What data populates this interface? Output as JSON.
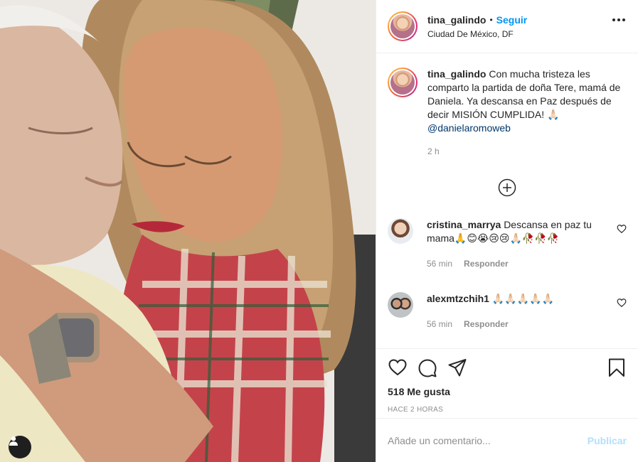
{
  "header": {
    "username": "tina_galindo",
    "separator": "•",
    "follow_label": "Seguir",
    "location": "Ciudad De México, DF"
  },
  "caption": {
    "username": "tina_galindo",
    "text": "Con mucha tristeza les comparto la partida de doña Tere, mamá de Daniela. Ya descansa en Paz después de decir MISIÓN CUMPLIDA! 🙏🏻",
    "mention": "@danielaromoweb",
    "time": "2 h"
  },
  "comments": [
    {
      "username": "cristina_marrya",
      "text": "Descansa en paz tu mama🙏😊😭😢😢🙏🏻🥀🥀🥀",
      "time": "56 min",
      "reply_label": "Responder"
    },
    {
      "username": "alexmtzchih1",
      "text": "🙏🏻🙏🏻🙏🏻🙏🏻🙏🏻",
      "time": "56 min",
      "reply_label": "Responder"
    }
  ],
  "actions": {
    "likes": "518 Me gusta",
    "posted": "HACE 2 HORAS"
  },
  "composer": {
    "placeholder": "Añade un comentario...",
    "publish_label": "Publicar"
  },
  "colors": {
    "accent": "#0095f6",
    "publish_disabled": "#b2dffc",
    "border": "#efefef",
    "muted": "#8e8e8e"
  }
}
